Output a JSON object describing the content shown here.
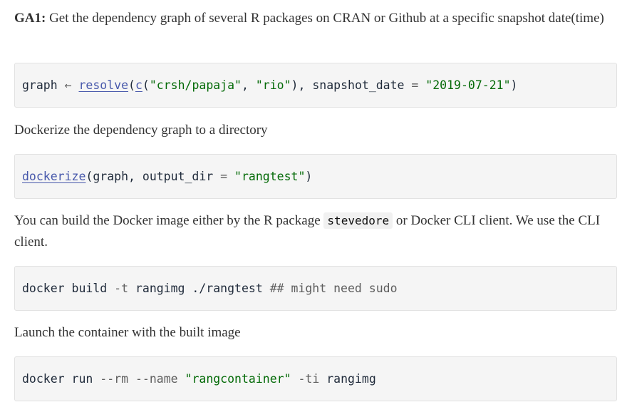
{
  "section1": {
    "label": "GA1:",
    "text": " Get the dependency graph of several R packages on CRAN or Github at a specific snapshot date(time)"
  },
  "code1": {
    "var": "graph",
    "assign": " ← ",
    "fn_resolve": "resolve",
    "paren_open": "(",
    "fn_c": "c",
    "paren_open2": "(",
    "str1": "\"crsh/papaja\"",
    "comma1": ", ",
    "str2": "\"rio\"",
    "close_comma": "), ",
    "arg": "snapshot_date",
    "eq": " = ",
    "str3": "\"2019-07-21\"",
    "close": ")"
  },
  "section2": {
    "text": "Dockerize the dependency graph to a directory"
  },
  "code2": {
    "fn": "dockerize",
    "open": "(",
    "arg1": "graph, output_dir",
    "eq": " = ",
    "str": "\"rangtest\"",
    "close": ")"
  },
  "section3": {
    "text_before": "You can build the Docker image either by the R package ",
    "inline_code": "stevedore",
    "text_after": " or Docker CLI client. We use the CLI client."
  },
  "code3": {
    "cmd": "docker build ",
    "flag": "-t",
    "rest": " rangimg ./rangtest ",
    "comment": "## might need sudo"
  },
  "section4": {
    "text": "Launch the container with the built image"
  },
  "code4": {
    "cmd": "docker run ",
    "flag1": "--rm",
    "space1": " ",
    "flag2": "--name",
    "space2": " ",
    "str": "\"rangcontainer\"",
    "space3": " ",
    "flag3": "-ti",
    "rest": " rangimg"
  }
}
